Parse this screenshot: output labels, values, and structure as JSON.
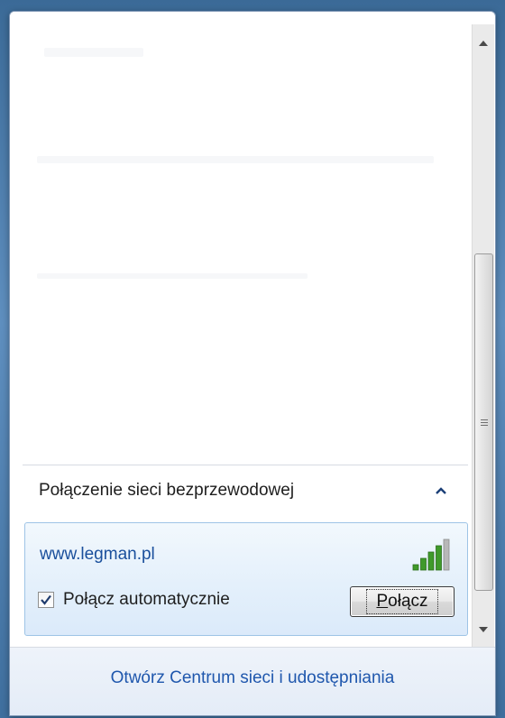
{
  "section": {
    "title": "Połączenie sieci bezprzewodowej"
  },
  "network": {
    "ssid": "www.legman.pl",
    "signal_bars": 4,
    "signal_max": 5,
    "auto_connect_label": "Połącz automatycznie",
    "auto_connect_checked": true,
    "connect_button": {
      "underlined_letter": "P",
      "rest": "ołącz"
    }
  },
  "footer": {
    "link_label": "Otwórz Centrum sieci i udostępniania"
  },
  "colors": {
    "link": "#1f57ad",
    "network_name": "#1a4f9c",
    "signal_active": "#3f9a2a",
    "signal_inactive": "#b8b8b8"
  }
}
